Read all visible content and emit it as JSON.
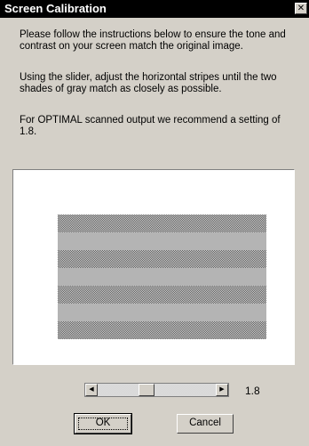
{
  "window": {
    "title": "Screen Calibration",
    "close_glyph": "✕"
  },
  "instructions": [
    "Please follow the instructions below to ensure the tone and contrast on your screen match the original image.",
    "Using the slider, adjust the horizontal stripes until the two shades of gray match as closely as possible.",
    "For OPTIMAL scanned output we recommend a setting of 1.8."
  ],
  "calibration": {
    "stripe_count": 7,
    "solid_gray": "#b4b4b4",
    "dither_dark": "#5f5f5f",
    "dither_light": "#cfcfcf"
  },
  "slider": {
    "left_arrow": "◀",
    "right_arrow": "▶",
    "position_fraction": 0.4,
    "value": "1.8"
  },
  "buttons": {
    "ok": "OK",
    "cancel": "Cancel"
  },
  "colors": {
    "titlebar_bg": "#000000",
    "dialog_bg": "#d4d0c8"
  }
}
